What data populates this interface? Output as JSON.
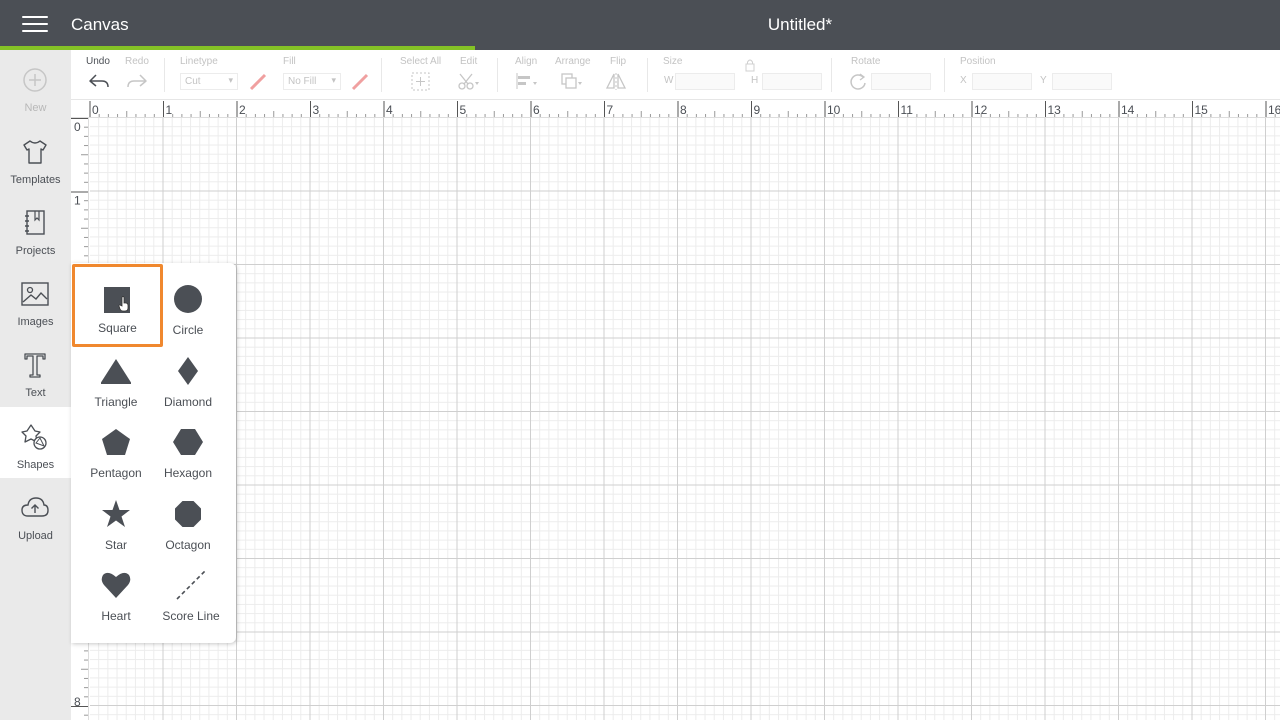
{
  "header": {
    "app_title": "Canvas",
    "doc_title": "Untitled*",
    "accent_color": "#84c225",
    "bg_color": "#4b4f55"
  },
  "sidebar": {
    "items": [
      {
        "label": "New",
        "icon": "plus-circle-icon",
        "enabled": false
      },
      {
        "label": "Templates",
        "icon": "tshirt-icon",
        "enabled": true
      },
      {
        "label": "Projects",
        "icon": "notebook-icon",
        "enabled": true
      },
      {
        "label": "Images",
        "icon": "image-icon",
        "enabled": true
      },
      {
        "label": "Text",
        "icon": "text-t-icon",
        "enabled": true
      },
      {
        "label": "Shapes",
        "icon": "shapes-icon",
        "enabled": true,
        "active": true
      },
      {
        "label": "Upload",
        "icon": "cloud-upload-icon",
        "enabled": true
      }
    ]
  },
  "toolbar": {
    "undo": "Undo",
    "redo": "Redo",
    "linetype_label": "Linetype",
    "linetype_value": "Cut",
    "fill_label": "Fill",
    "fill_value": "No Fill",
    "select_all": "Select All",
    "edit": "Edit",
    "align": "Align",
    "arrange": "Arrange",
    "flip": "Flip",
    "size_label": "Size",
    "size_w": "W",
    "size_h": "H",
    "rotate_label": "Rotate",
    "position_label": "Position",
    "position_x": "X",
    "position_y": "Y"
  },
  "ruler": {
    "top_ticks": [
      "0",
      "1",
      "2",
      "3",
      "4",
      "5",
      "6",
      "7",
      "8",
      "9",
      "10",
      "11",
      "12",
      "13",
      "14",
      "15",
      "16"
    ],
    "left_ticks": [
      "0",
      "1",
      "8"
    ]
  },
  "shapes_panel": {
    "selected": "Square",
    "highlight_color": "#f0882e",
    "shapes": [
      {
        "label": "Square",
        "icon": "square-icon"
      },
      {
        "label": "Circle",
        "icon": "circle-icon"
      },
      {
        "label": "Triangle",
        "icon": "triangle-icon"
      },
      {
        "label": "Diamond",
        "icon": "diamond-icon"
      },
      {
        "label": "Pentagon",
        "icon": "pentagon-icon"
      },
      {
        "label": "Hexagon",
        "icon": "hexagon-icon"
      },
      {
        "label": "Star",
        "icon": "star-icon"
      },
      {
        "label": "Octagon",
        "icon": "octagon-icon"
      },
      {
        "label": "Heart",
        "icon": "heart-icon"
      },
      {
        "label": "Score Line",
        "icon": "score-line-icon"
      }
    ]
  }
}
